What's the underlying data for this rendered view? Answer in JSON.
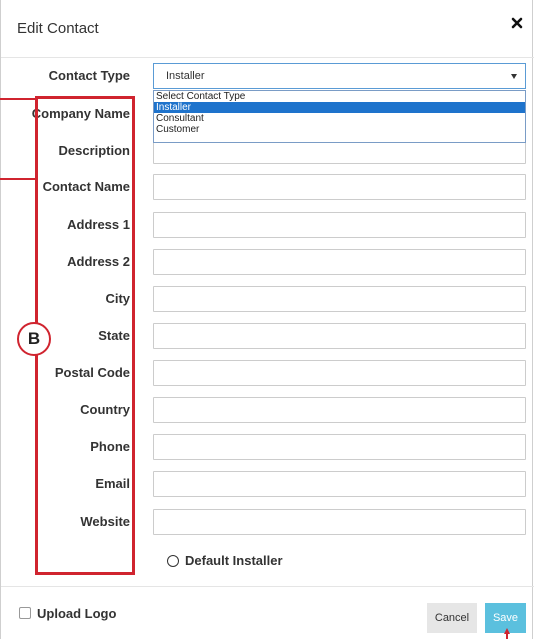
{
  "dialog": {
    "title": "Edit Contact",
    "close_icon": "close-icon"
  },
  "contact_type": {
    "label": "Contact Type",
    "selected": "Installer",
    "options": [
      "Select Contact Type",
      "Installer",
      "Consultant",
      "Customer"
    ]
  },
  "fields": [
    {
      "label": "Company Name"
    },
    {
      "label": "Description"
    },
    {
      "label": "Contact Name"
    },
    {
      "label": "Address 1"
    },
    {
      "label": "Address 2"
    },
    {
      "label": "City"
    },
    {
      "label": "State"
    },
    {
      "label": "Postal Code"
    },
    {
      "label": "Country"
    },
    {
      "label": "Phone"
    },
    {
      "label": "Email"
    },
    {
      "label": "Website"
    }
  ],
  "default_installer": {
    "label": "Default Installer",
    "checked": false
  },
  "footer": {
    "upload_logo_label": "Upload Logo",
    "cancel_label": "Cancel",
    "save_label": "Save"
  },
  "annotation": {
    "callout_letter": "B",
    "color": "#d0242f"
  }
}
